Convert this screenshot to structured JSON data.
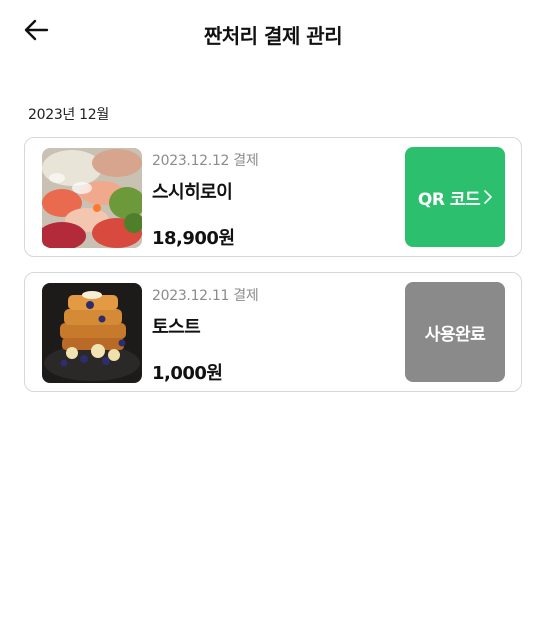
{
  "header": {
    "title": "짠처리 결제 관리",
    "back_icon": "arrow-left-icon"
  },
  "sections": [
    {
      "month": "2023년 12월",
      "payments": [
        {
          "date": "2023.12.12 결제",
          "store": "스시히로이",
          "price": "18,900원",
          "image": "sushi-platter-photo",
          "action_label": "QR 코드",
          "action_icon": "chevron-right-icon",
          "action_color": "#2bbf6e"
        },
        {
          "date": "2023.12.11 결제",
          "store": "토스트",
          "price": "1,000원",
          "image": "french-toast-photo",
          "action_label": "사용완료",
          "action_color": "#8a8a8a"
        }
      ]
    }
  ]
}
